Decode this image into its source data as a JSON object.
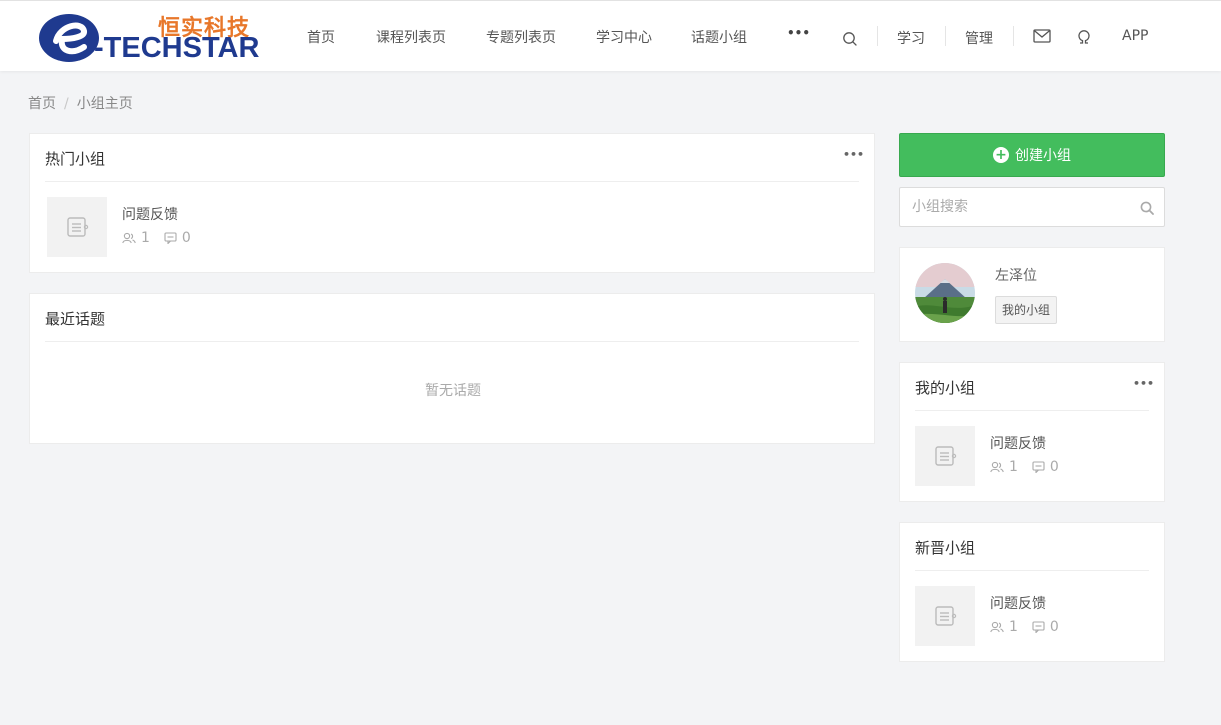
{
  "header": {
    "logo_cn": "恒实科技",
    "logo_en": "-TECHSTAR",
    "nav": [
      "首页",
      "课程列表页",
      "专题列表页",
      "学习中心",
      "话题小组"
    ],
    "more": "•••",
    "right_links": {
      "learn": "学习",
      "manage": "管理",
      "app": "APP"
    }
  },
  "breadcrumb": {
    "home": "首页",
    "separator": "/",
    "current": "小组主页"
  },
  "hot_groups": {
    "title": "热门小组",
    "more": "•••",
    "items": [
      {
        "name": "问题反馈",
        "members": "1",
        "topics": "0"
      }
    ]
  },
  "recent_topics": {
    "title": "最近话题",
    "empty": "暂无话题"
  },
  "sidebar": {
    "create_button": "创建小组",
    "search_placeholder": "小组搜索",
    "user": {
      "name": "左泽位",
      "my_groups_tag": "我的小组"
    },
    "my_groups": {
      "title": "我的小组",
      "more": "•••",
      "items": [
        {
          "name": "问题反馈",
          "members": "1",
          "topics": "0"
        }
      ]
    },
    "new_groups": {
      "title": "新晋小组",
      "items": [
        {
          "name": "问题反馈",
          "members": "1",
          "topics": "0"
        }
      ]
    }
  },
  "colors": {
    "accent_green": "#43bd5d",
    "logo_orange": "#e8772a",
    "logo_blue": "#1f3a8f"
  }
}
